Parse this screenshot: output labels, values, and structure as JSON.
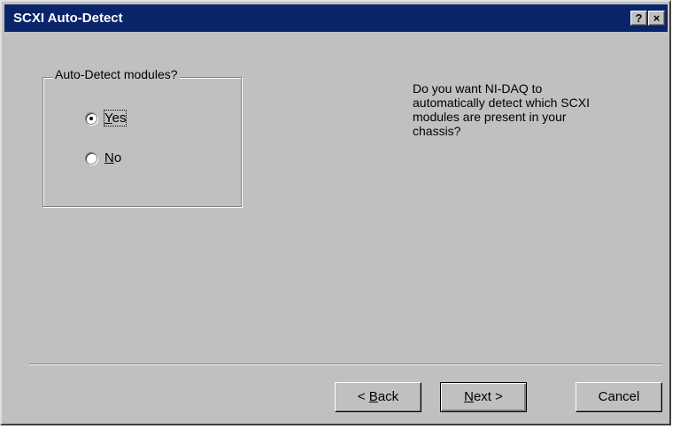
{
  "window": {
    "title": "SCXI Auto-Detect",
    "help_button": "?",
    "close_button": "×"
  },
  "group": {
    "label": "Auto-Detect modules?",
    "options": [
      {
        "label_mnemonic": "Y",
        "label_rest": "es",
        "selected": true
      },
      {
        "label_mnemonic": "N",
        "label_rest": "o",
        "selected": false
      }
    ]
  },
  "question": {
    "line1": "Do you want NI-DAQ to",
    "line2": "automatically detect which SCXI",
    "line3": "modules are present in your",
    "line4": "chassis?"
  },
  "buttons": {
    "back_prefix": "< ",
    "back_mnemonic": "B",
    "back_rest": "ack",
    "next_mnemonic": "N",
    "next_rest": "ext >",
    "cancel": "Cancel"
  }
}
